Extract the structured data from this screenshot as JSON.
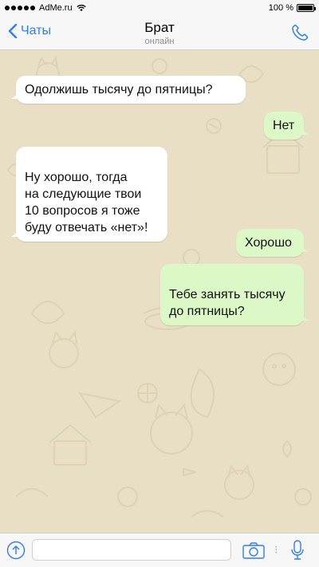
{
  "status_bar": {
    "carrier": "AdMe.ru",
    "battery": "100 %"
  },
  "nav": {
    "back_label": "Чаты",
    "title": "Брат",
    "subtitle": "онлайн"
  },
  "messages": [
    {
      "direction": "incoming",
      "text": "Одолжишь тысячу до пятницы?"
    },
    {
      "direction": "outgoing",
      "text": "Нет"
    },
    {
      "direction": "incoming",
      "text": "Ну хорошо, тогда\nна следующие твои\n10 вопросов я тоже\nбуду отвечать «нет»!"
    },
    {
      "direction": "outgoing",
      "text": "Хорошо"
    },
    {
      "direction": "outgoing",
      "text": "Тебе занять тысячу\nдо пятницы?"
    }
  ],
  "input": {
    "value": "",
    "placeholder": ""
  },
  "colors": {
    "accent": "#2f7cf6",
    "chat_background": "#e8dfc5",
    "incoming_bubble": "#ffffff",
    "outgoing_bubble": "#dcf8c6"
  },
  "icons": [
    "signal-icon",
    "wifi-icon",
    "battery-icon",
    "back-chevron-icon",
    "phone-icon",
    "upload-icon",
    "camera-icon",
    "microphone-icon"
  ]
}
